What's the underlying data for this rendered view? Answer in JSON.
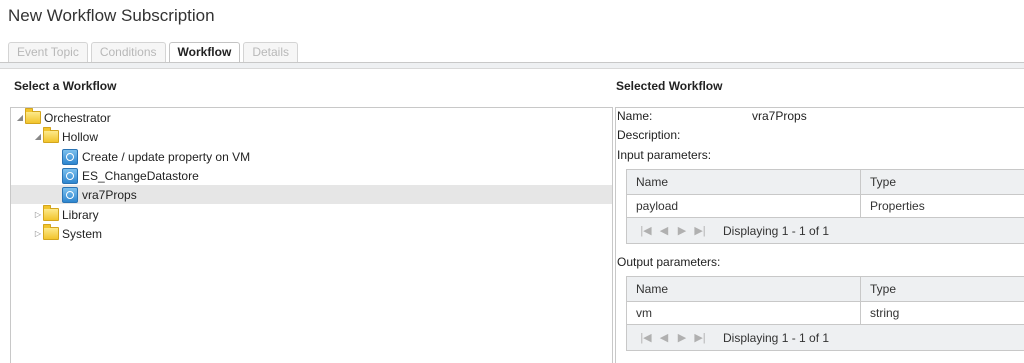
{
  "page_title": "New Workflow Subscription",
  "tabs": [
    {
      "label": "Event Topic",
      "active": false
    },
    {
      "label": "Conditions",
      "active": false
    },
    {
      "label": "Workflow",
      "active": true
    },
    {
      "label": "Details",
      "active": false
    }
  ],
  "left": {
    "header": "Select a Workflow",
    "tree": [
      {
        "label": "Orchestrator",
        "type": "folder",
        "expanded": true
      },
      {
        "label": "Hollow",
        "type": "folder",
        "expanded": true
      },
      {
        "label": "Create / update property on VM",
        "type": "workflow"
      },
      {
        "label": "ES_ChangeDatastore",
        "type": "workflow"
      },
      {
        "label": "vra7Props",
        "type": "workflow",
        "selected": true
      },
      {
        "label": "Library",
        "type": "folder",
        "expanded": false
      },
      {
        "label": "System",
        "type": "folder",
        "expanded": false
      }
    ]
  },
  "right": {
    "header": "Selected Workflow",
    "name_label": "Name:",
    "name_value": "vra7Props",
    "description_label": "Description:",
    "input_label": "Input parameters:",
    "output_label": "Output parameters:",
    "col_name": "Name",
    "col_type": "Type",
    "input_rows": [
      {
        "name": "payload",
        "type": "Properties"
      }
    ],
    "output_rows": [
      {
        "name": "vm",
        "type": "string"
      }
    ],
    "pager_text": "Displaying 1 - 1 of 1"
  },
  "icons": {
    "expanded": "triangle-down",
    "collapsed": "triangle-right",
    "folder": "folder-icon",
    "workflow": "workflow-icon",
    "pager": [
      "first-page-icon",
      "prev-page-icon",
      "next-page-icon",
      "last-page-icon"
    ]
  }
}
